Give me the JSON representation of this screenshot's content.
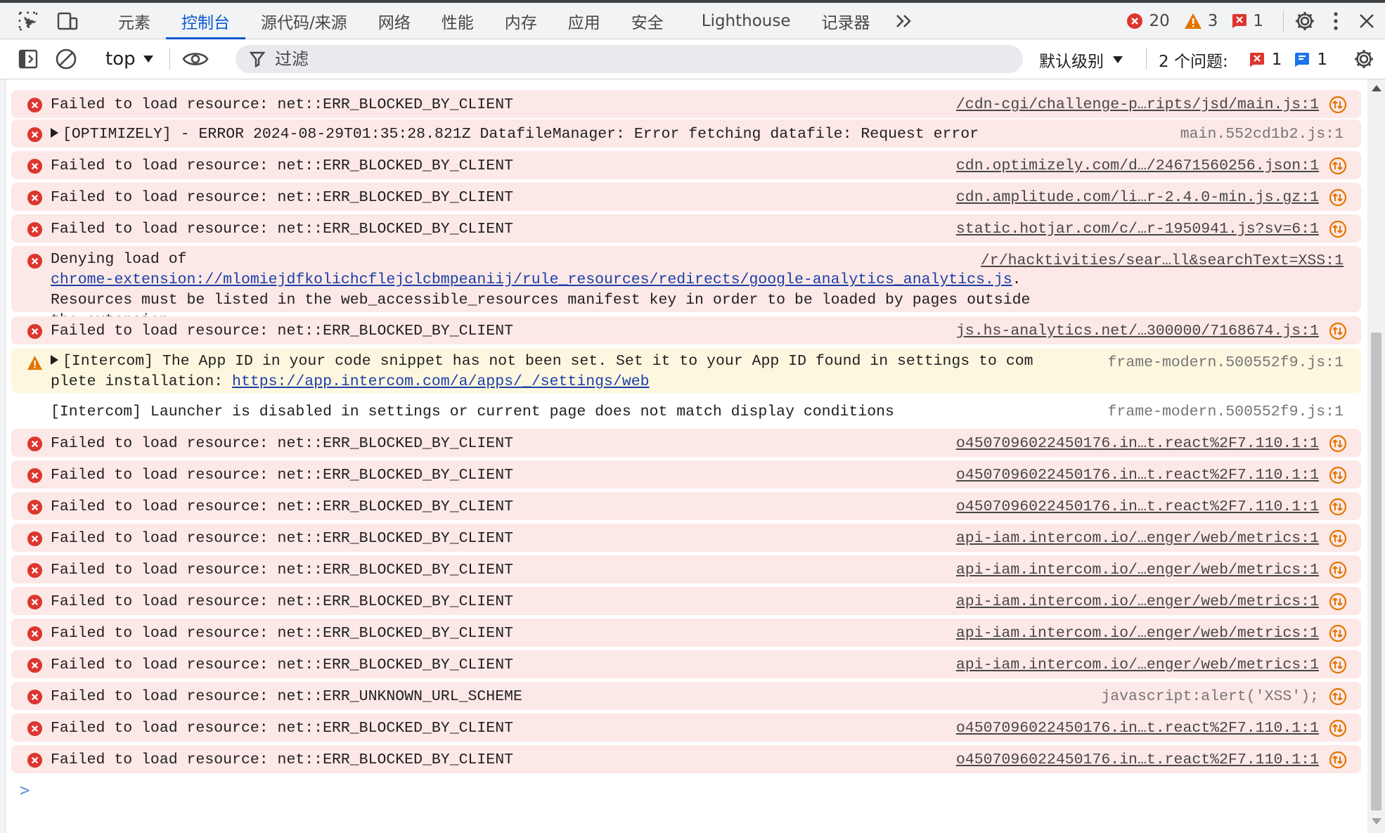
{
  "colors": {
    "accent": "#0b57d0",
    "error_bg": "#fce8e6",
    "warn_bg": "#fef7e0",
    "error_icon": "#dc362e",
    "warn_icon": "#e37400"
  },
  "tabs": [
    {
      "label": "元素"
    },
    {
      "label": "控制台"
    },
    {
      "label": "源代码/来源"
    },
    {
      "label": "网络"
    },
    {
      "label": "性能"
    },
    {
      "label": "内存"
    },
    {
      "label": "应用"
    },
    {
      "label": "安全"
    },
    {
      "label": "Lighthouse"
    },
    {
      "label": "记录器"
    }
  ],
  "counts": {
    "errors": "20",
    "warnings": "3",
    "issues": "1"
  },
  "toolbar": {
    "context": "top",
    "filter_placeholder": "过滤",
    "level": "默认级别",
    "issues_label": "2 个问题:",
    "issues_error": "1",
    "issues_info": "1"
  },
  "messages": [
    {
      "type": "error",
      "text": "Failed to load resource: net::ERR_BLOCKED_BY_CLIENT",
      "source": "/cdn-cgi/challenge-p…ripts/jsd/main.js:1"
    },
    {
      "type": "error",
      "text": "[OPTIMIZELY] - ERROR 2024-08-29T01:35:28.821Z DatafileManager: Error fetching datafile: Request error",
      "source": "main.552cd1b2.js:1"
    },
    {
      "type": "error",
      "text": "Failed to load resource: net::ERR_BLOCKED_BY_CLIENT",
      "source": "cdn.optimizely.com/d…/24671560256.json:1"
    },
    {
      "type": "error",
      "text": "Failed to load resource: net::ERR_BLOCKED_BY_CLIENT",
      "source": "cdn.amplitude.com/li…r-2.4.0-min.js.gz:1"
    },
    {
      "type": "error",
      "text": "Failed to load resource: net::ERR_BLOCKED_BY_CLIENT",
      "source": "static.hotjar.com/c/…r-1950941.js?sv=6:1"
    },
    {
      "type": "error",
      "text_prefix": "Denying load of ",
      "link": "chrome-extension://mlomiejdfkolichcflejclcbmpeaniij/rule_resources/redirects/google-analytics_analytics.js",
      "text_suffix": ". Resources must be listed in the web_accessible_resources manifest key in order to be loaded by pages outside the extension.",
      "source": "/r/hacktivities/sear…ll&searchText=XSS:1"
    },
    {
      "type": "error",
      "text": "Failed to load resource: net::ERR_BLOCKED_BY_CLIENT",
      "source": "js.hs-analytics.net/…300000/7168674.js:1"
    },
    {
      "type": "warn",
      "text": "[Intercom] The App ID in your code snippet has not been set. Set it to your App ID found in settings to complete installation: ",
      "link": "https://app.intercom.com/a/apps/_/settings/web",
      "source": "frame-modern.500552f9.js:1"
    },
    {
      "type": "info",
      "text": "[Intercom] Launcher is disabled in settings or current page does not match display conditions",
      "source": "frame-modern.500552f9.js:1"
    },
    {
      "type": "error",
      "text": "Failed to load resource: net::ERR_BLOCKED_BY_CLIENT",
      "source": "o4507096022450176.in…t.react%2F7.110.1:1"
    },
    {
      "type": "error",
      "text": "Failed to load resource: net::ERR_BLOCKED_BY_CLIENT",
      "source": "o4507096022450176.in…t.react%2F7.110.1:1"
    },
    {
      "type": "error",
      "text": "Failed to load resource: net::ERR_BLOCKED_BY_CLIENT",
      "source": "o4507096022450176.in…t.react%2F7.110.1:1"
    },
    {
      "type": "error",
      "text": "Failed to load resource: net::ERR_BLOCKED_BY_CLIENT",
      "source": "api-iam.intercom.io/…enger/web/metrics:1"
    },
    {
      "type": "error",
      "text": "Failed to load resource: net::ERR_BLOCKED_BY_CLIENT",
      "source": "api-iam.intercom.io/…enger/web/metrics:1"
    },
    {
      "type": "error",
      "text": "Failed to load resource: net::ERR_BLOCKED_BY_CLIENT",
      "source": "api-iam.intercom.io/…enger/web/metrics:1"
    },
    {
      "type": "error",
      "text": "Failed to load resource: net::ERR_BLOCKED_BY_CLIENT",
      "source": "api-iam.intercom.io/…enger/web/metrics:1"
    },
    {
      "type": "error",
      "text": "Failed to load resource: net::ERR_BLOCKED_BY_CLIENT",
      "source": "api-iam.intercom.io/…enger/web/metrics:1"
    },
    {
      "type": "error",
      "text": "Failed to load resource: net::ERR_UNKNOWN_URL_SCHEME",
      "source": "javascript:alert('XSS');"
    },
    {
      "type": "error",
      "text": "Failed to load resource: net::ERR_BLOCKED_BY_CLIENT",
      "source": "o4507096022450176.in…t.react%2F7.110.1:1"
    },
    {
      "type": "error",
      "text": "Failed to load resource: net::ERR_BLOCKED_BY_CLIENT",
      "source": "o4507096022450176.in…t.react%2F7.110.1:1"
    }
  ],
  "prompt": ">"
}
